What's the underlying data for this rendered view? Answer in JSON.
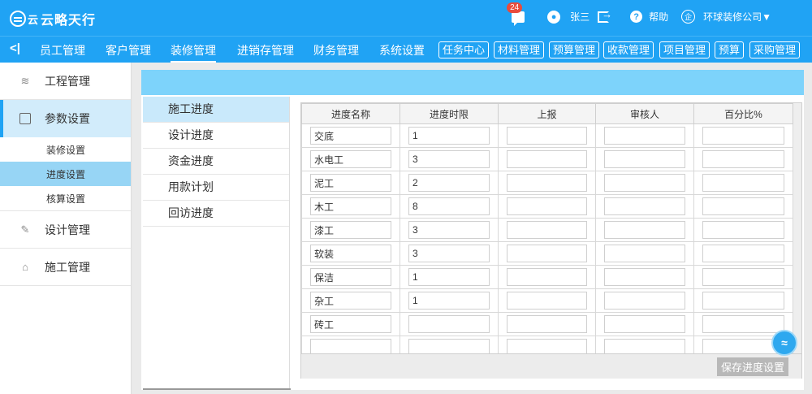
{
  "header": {
    "logo_sub": "云",
    "logo_text": "云略天行",
    "badge_count": "24",
    "user_name": "张三",
    "help_label": "帮助",
    "company": "环球装修公司▼"
  },
  "nav": {
    "toggle": "<|",
    "items": [
      "员工管理",
      "客户管理",
      "装修管理",
      "进销存管理",
      "财务管理",
      "系统设置"
    ],
    "buttons": [
      "任务中心",
      "材料管理",
      "预算管理",
      "收款管理",
      "项目管理",
      "预算",
      "采购管理"
    ]
  },
  "sidebar": {
    "groups": [
      {
        "label": "工程管理"
      },
      {
        "label": "参数设置"
      },
      {
        "label": "设计管理"
      },
      {
        "label": "施工管理"
      }
    ],
    "subitems": [
      "装修设置",
      "进度设置",
      "核算设置"
    ]
  },
  "tabs": [
    "施工进度",
    "设计进度",
    "资金进度",
    "用款计划",
    "回访进度"
  ],
  "table": {
    "headers": [
      "进度名称",
      "进度时限",
      "上报",
      "审核人",
      "百分比%"
    ],
    "rows": [
      [
        "交底",
        "1",
        "",
        "",
        ""
      ],
      [
        "水电工",
        "3",
        "",
        "",
        ""
      ],
      [
        "泥工",
        "2",
        "",
        "",
        ""
      ],
      [
        "木工",
        "8",
        "",
        "",
        ""
      ],
      [
        "漆工",
        "3",
        "",
        "",
        ""
      ],
      [
        "软装",
        "3",
        "",
        "",
        ""
      ],
      [
        "保洁",
        "1",
        "",
        "",
        ""
      ],
      [
        "杂工",
        "1",
        "",
        "",
        ""
      ],
      [
        "砖工",
        "",
        "",
        "",
        ""
      ],
      [
        "",
        "",
        "",
        "",
        ""
      ]
    ]
  },
  "save_button": "保存进度设置",
  "colors": {
    "primary": "#20a3f4",
    "panel_header": "#7dd3fb",
    "active_tab": "#c9e9fb",
    "active_subitem": "#97d5f5",
    "badge": "#e94b3c"
  }
}
